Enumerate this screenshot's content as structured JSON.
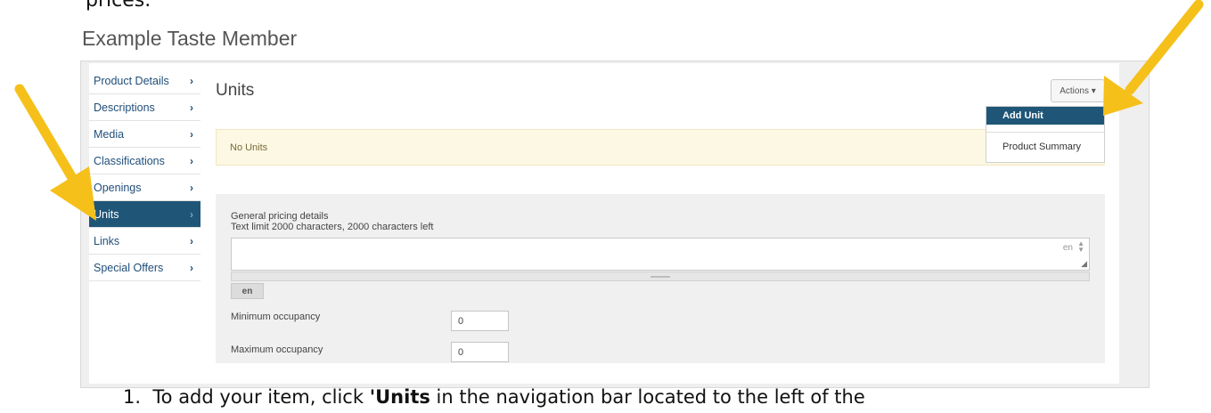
{
  "document": {
    "top_text": "prices.",
    "instruction_number": "1.",
    "instruction_before": "To add your item, click ",
    "instruction_bold": "'Units",
    "instruction_after": " in the navigation bar located to the left of the"
  },
  "app": {
    "title": "Example Taste Member"
  },
  "sidebar": {
    "items": [
      {
        "label": "Product Details"
      },
      {
        "label": "Descriptions"
      },
      {
        "label": "Media"
      },
      {
        "label": "Classifications"
      },
      {
        "label": "Openings"
      },
      {
        "label": "Units",
        "active": true
      },
      {
        "label": "Links"
      },
      {
        "label": "Special Offers"
      }
    ],
    "chevron": "›"
  },
  "main": {
    "heading": "Units",
    "actions_label": "Actions ▾",
    "dropdown": {
      "items": [
        "Add Unit",
        "Product Summary"
      ]
    },
    "alert_text": "No Units",
    "pricing": {
      "label": "General pricing details",
      "limit_text": "Text limit 2000 characters, 2000 characters left",
      "lang_indicator": "en",
      "lang_tab": "en",
      "min_label": "Minimum occupancy",
      "min_value": "0",
      "max_label": "Maximum occupancy",
      "max_value": "0"
    }
  },
  "colors": {
    "accent": "#1f5678",
    "arrow": "#f5c01a",
    "alert_bg": "#fcf8e3"
  }
}
